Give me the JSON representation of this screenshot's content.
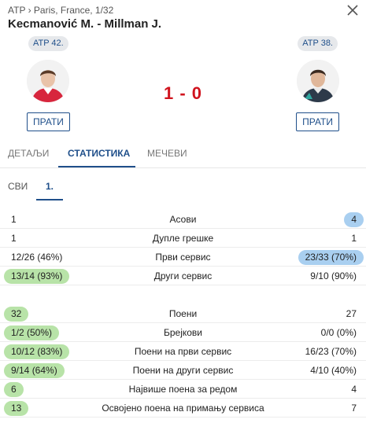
{
  "header": {
    "breadcrumb": "ATP › Paris, France, 1/32",
    "title": "Kecmanović M. - Millman J."
  },
  "players": {
    "left": {
      "rank": "ATP 42.",
      "follow_label": "ПРАТИ"
    },
    "right": {
      "rank": "ATP 38.",
      "follow_label": "ПРАТИ"
    }
  },
  "score": "1 - 0",
  "tabs": [
    {
      "label": "ДЕТАЉИ"
    },
    {
      "label": "СТАТИСТИКА",
      "active": true
    },
    {
      "label": "МЕЧЕВИ"
    }
  ],
  "subtabs": [
    {
      "label": "СВИ"
    },
    {
      "label": "1.",
      "active": true
    }
  ],
  "stats_group1": [
    {
      "label": "Асови",
      "left": "1",
      "right": "4",
      "highlight": "right",
      "color": "#a9cff0"
    },
    {
      "label": "Дупле грешке",
      "left": "1",
      "right": "1",
      "highlight": "none"
    },
    {
      "label": "Први сервис",
      "left": "12/26 (46%)",
      "right": "23/33 (70%)",
      "highlight": "right",
      "color": "#a9cff0"
    },
    {
      "label": "Други сервис",
      "left": "13/14 (93%)",
      "right": "9/10 (90%)",
      "highlight": "left",
      "color": "#b8e3a8"
    }
  ],
  "stats_group2": [
    {
      "label": "Поени",
      "left": "32",
      "right": "27",
      "highlight": "left",
      "color": "#b8e3a8"
    },
    {
      "label": "Брејкови",
      "left": "1/2 (50%)",
      "right": "0/0 (0%)",
      "highlight": "left",
      "color": "#b8e3a8"
    },
    {
      "label": "Поени на први сервис",
      "left": "10/12 (83%)",
      "right": "16/23 (70%)",
      "highlight": "left",
      "color": "#b8e3a8"
    },
    {
      "label": "Поени на други сервис",
      "left": "9/14 (64%)",
      "right": "4/10 (40%)",
      "highlight": "left",
      "color": "#b8e3a8"
    },
    {
      "label": "Највише поена за редом",
      "left": "6",
      "right": "4",
      "highlight": "left",
      "color": "#b8e3a8"
    },
    {
      "label": "Освојено поена на примању сервиса",
      "left": "13",
      "right": "7",
      "highlight": "left",
      "color": "#b8e3a8"
    }
  ]
}
